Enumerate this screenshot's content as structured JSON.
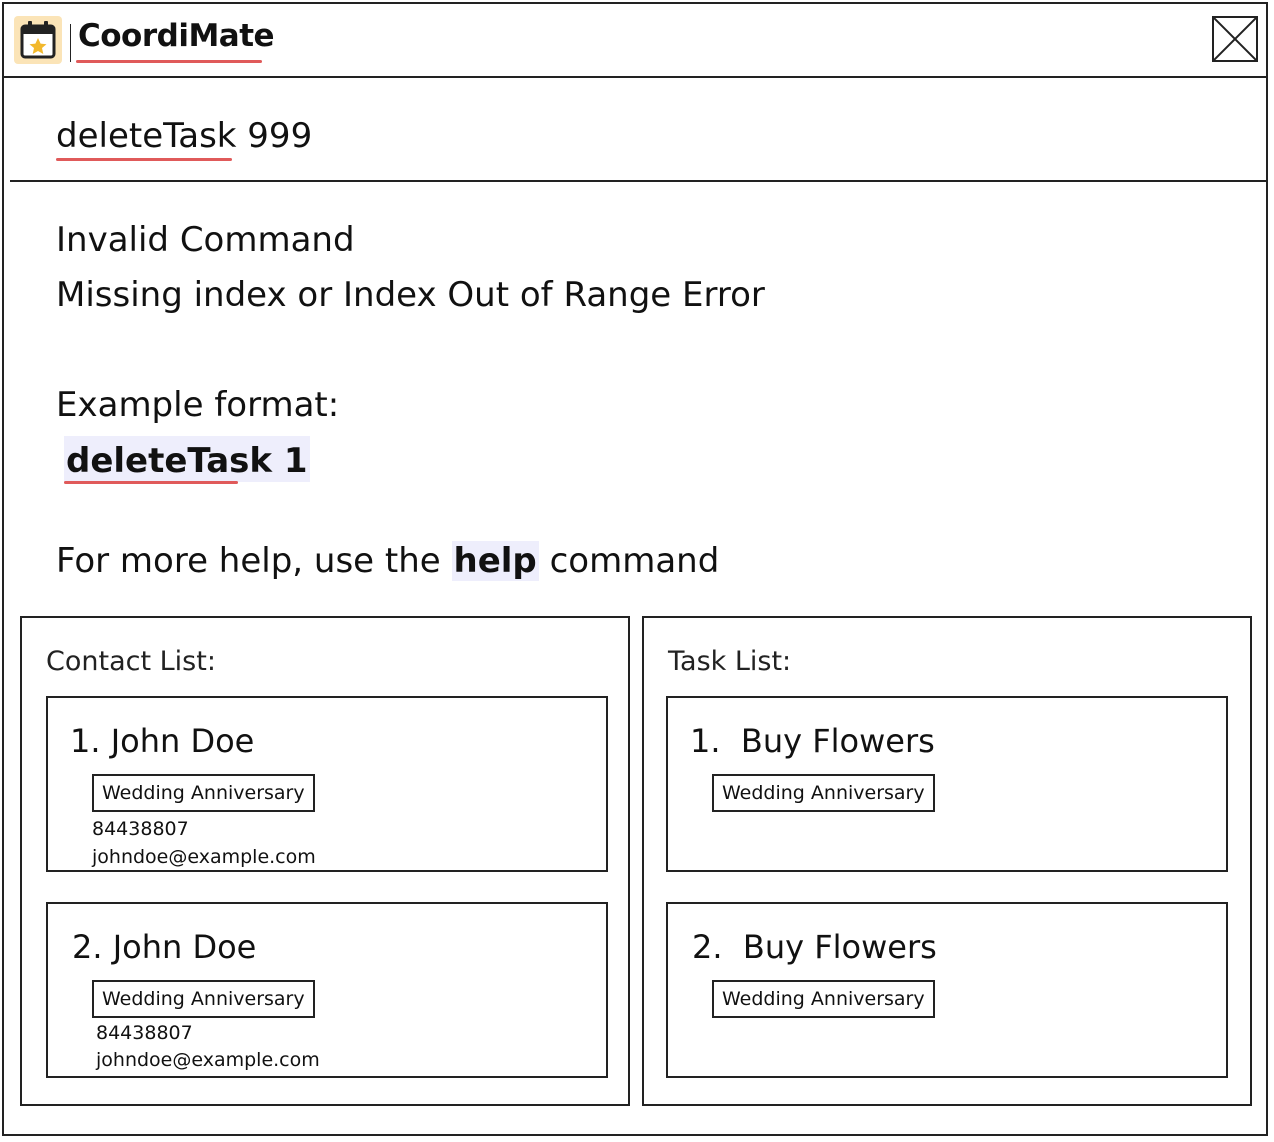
{
  "app": {
    "title": "CoordiMate",
    "icon": "calendar-star-icon",
    "close_icon": "close-icon"
  },
  "command": {
    "value": "deleteTask 999"
  },
  "result": {
    "line1": "Invalid Command",
    "line2": "Missing index or Index Out of Range Error",
    "example_label": "Example format:",
    "example_code": "deleteTask 1",
    "help_prefix": "For more help, use the ",
    "help_keyword": "help",
    "help_suffix": " command"
  },
  "contact_list": {
    "title": "Contact List:",
    "items": [
      {
        "name": "1. John Doe",
        "tag": "Wedding Anniversary",
        "phone": "84438807",
        "email": "johndoe@example.com"
      },
      {
        "name": "2. John Doe",
        "tag": "Wedding Anniversary",
        "phone": "84438807",
        "email": "johndoe@example.com"
      }
    ]
  },
  "task_list": {
    "title": "Task List:",
    "items": [
      {
        "name": "1.  Buy Flowers",
        "tag": "Wedding Anniversary"
      },
      {
        "name": "2.  Buy Flowers",
        "tag": "Wedding Anniversary"
      }
    ]
  },
  "colors": {
    "border": "#222222",
    "spellcheck_underline": "#e05a5a",
    "highlight": "#eeeefc",
    "icon_bg": "#fbe4b7",
    "icon_star": "#f2b82c"
  }
}
